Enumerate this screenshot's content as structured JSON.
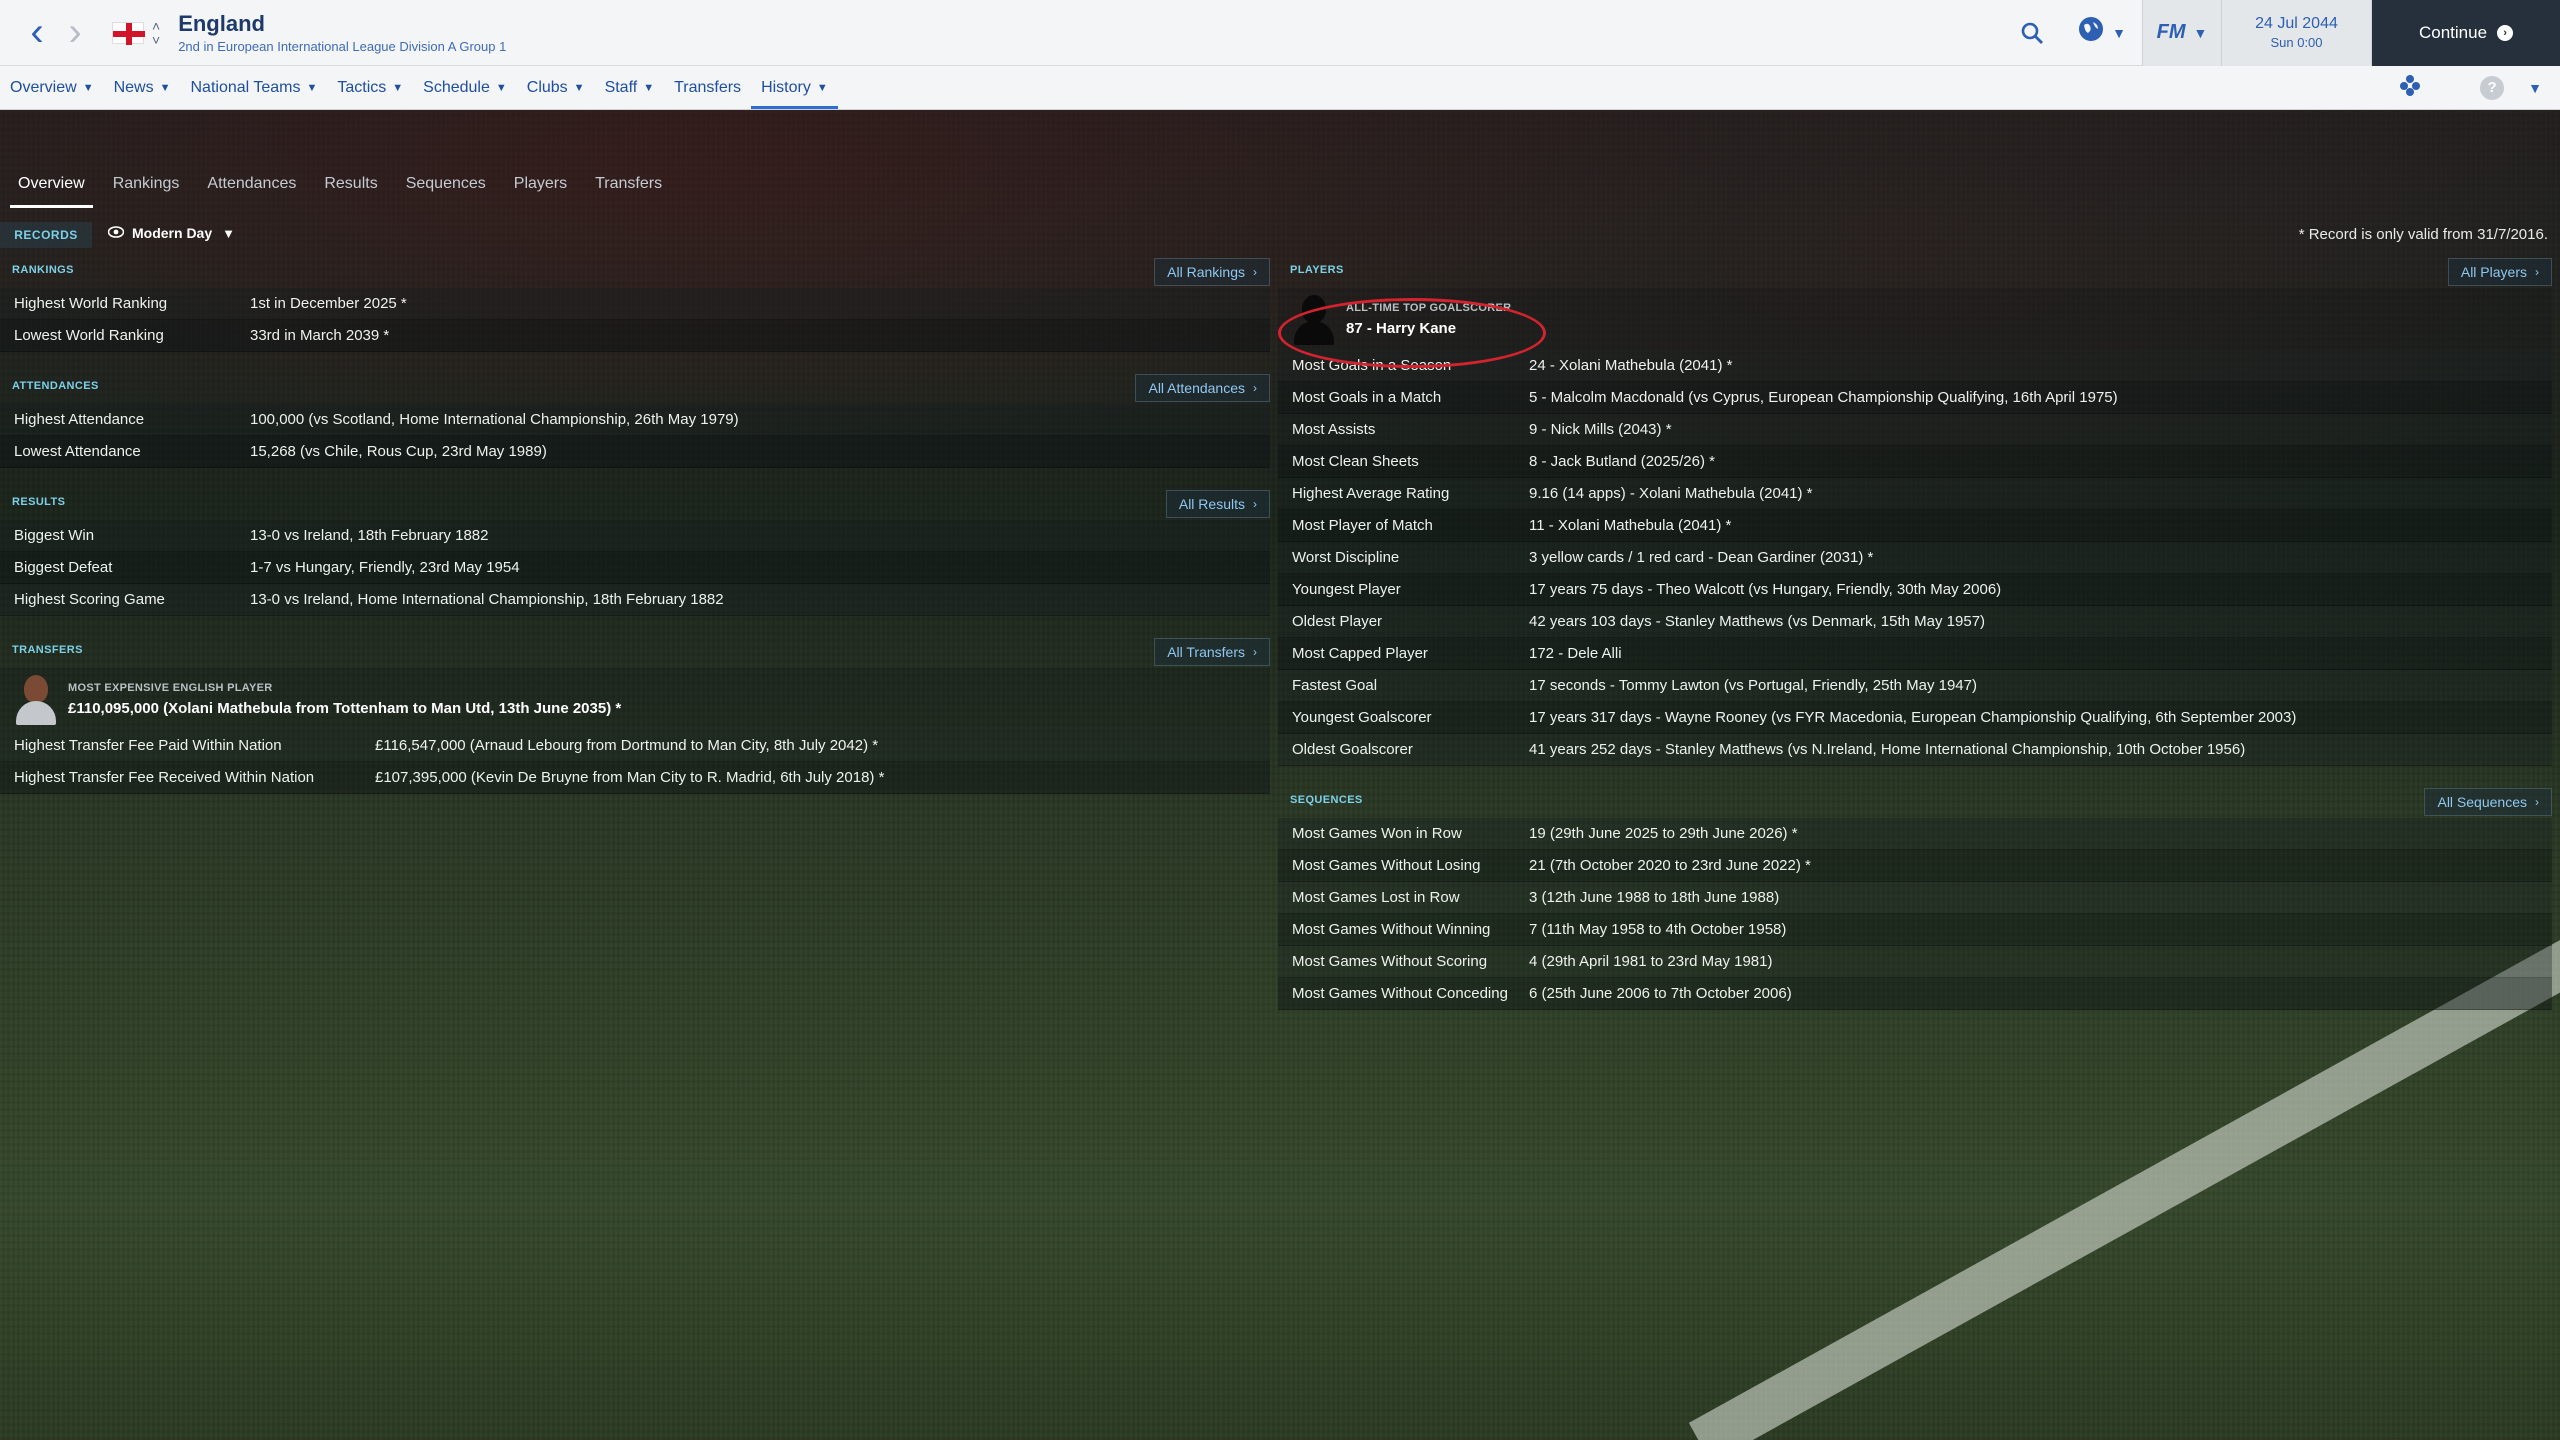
{
  "header": {
    "title": "England",
    "subtitle": "2nd in European International League Division A Group 1",
    "date": "24 Jul 2044",
    "time": "Sun 0:00",
    "continue_label": "Continue",
    "fm_label": "FM"
  },
  "menu": [
    {
      "label": "Overview",
      "has_dropdown": true
    },
    {
      "label": "News",
      "has_dropdown": true
    },
    {
      "label": "National Teams",
      "has_dropdown": true
    },
    {
      "label": "Tactics",
      "has_dropdown": true
    },
    {
      "label": "Schedule",
      "has_dropdown": true
    },
    {
      "label": "Clubs",
      "has_dropdown": true
    },
    {
      "label": "Staff",
      "has_dropdown": true
    },
    {
      "label": "Transfers",
      "has_dropdown": false
    },
    {
      "label": "History",
      "has_dropdown": true,
      "active": true
    }
  ],
  "tabs": [
    "Overview",
    "Rankings",
    "Attendances",
    "Results",
    "Sequences",
    "Players",
    "Transfers"
  ],
  "active_tab": "Overview",
  "records": {
    "label": "RECORDS",
    "filter": "Modern Day",
    "note": "* Record is only valid from 31/7/2016."
  },
  "rankings": {
    "title": "RANKINGS",
    "button": "All Rankings",
    "rows": [
      {
        "label": "Highest World Ranking",
        "value": "1st in December 2025 *"
      },
      {
        "label": "Lowest World Ranking",
        "value": "33rd in March 2039 *"
      }
    ]
  },
  "attendances": {
    "title": "ATTENDANCES",
    "button": "All Attendances",
    "rows": [
      {
        "label": "Highest Attendance",
        "value": "100,000 (vs Scotland, Home International Championship, 26th May 1979)"
      },
      {
        "label": "Lowest Attendance",
        "value": "15,268 (vs Chile, Rous Cup, 23rd May 1989)"
      }
    ]
  },
  "results": {
    "title": "RESULTS",
    "button": "All Results",
    "rows": [
      {
        "label": "Biggest Win",
        "value": "13-0 vs Ireland, 18th February 1882"
      },
      {
        "label": "Biggest Defeat",
        "value": "1-7 vs Hungary, Friendly, 23rd May 1954"
      },
      {
        "label": "Highest Scoring Game",
        "value": "13-0 vs Ireland, Home International Championship, 18th February 1882"
      }
    ]
  },
  "transfers": {
    "title": "TRANSFERS",
    "button": "All Transfers",
    "feature_caption": "MOST EXPENSIVE ENGLISH PLAYER",
    "feature_value": "£110,095,000 (Xolani Mathebula from Tottenham to Man Utd, 13th June 2035) *",
    "rows": [
      {
        "label": "Highest Transfer Fee Paid Within Nation",
        "value": "£116,547,000 (Arnaud Lebourg from Dortmund to Man City, 8th July 2042) *"
      },
      {
        "label": "Highest Transfer Fee Received Within Nation",
        "value": "£107,395,000 (Kevin De Bruyne from Man City to R. Madrid, 6th July 2018) *"
      }
    ]
  },
  "players": {
    "title": "PLAYERS",
    "button": "All Players",
    "feature_caption": "ALL-TIME TOP GOALSCORER",
    "feature_value": "87 - Harry Kane",
    "rows": [
      {
        "label": "Most Goals in a Season",
        "value": "24 - Xolani Mathebula (2041) *"
      },
      {
        "label": "Most Goals in a Match",
        "value": "5 - Malcolm Macdonald (vs Cyprus, European Championship Qualifying, 16th April 1975)"
      },
      {
        "label": "Most Assists",
        "value": "9 - Nick Mills (2043) *"
      },
      {
        "label": "Most Clean Sheets",
        "value": "8 - Jack Butland (2025/26) *"
      },
      {
        "label": "Highest Average Rating",
        "value": "9.16 (14 apps) - Xolani Mathebula (2041) *"
      },
      {
        "label": "Most Player of Match",
        "value": "11 - Xolani Mathebula (2041) *"
      },
      {
        "label": "Worst Discipline",
        "value": "3 yellow cards / 1 red card - Dean Gardiner (2031) *"
      },
      {
        "label": "Youngest Player",
        "value": "17 years 75 days - Theo Walcott (vs Hungary, Friendly, 30th May 2006)"
      },
      {
        "label": "Oldest Player",
        "value": "42 years 103 days - Stanley Matthews (vs Denmark, 15th May 1957)"
      },
      {
        "label": "Most Capped Player",
        "value": "172 - Dele Alli"
      },
      {
        "label": "Fastest Goal",
        "value": "17 seconds - Tommy Lawton (vs Portugal, Friendly, 25th May 1947)"
      },
      {
        "label": "Youngest Goalscorer",
        "value": "17 years 317 days - Wayne Rooney (vs FYR Macedonia, European Championship Qualifying, 6th September 2003)"
      },
      {
        "label": "Oldest Goalscorer",
        "value": "41 years 252 days - Stanley Matthews (vs N.Ireland, Home International Championship, 10th October 1956)"
      }
    ]
  },
  "sequences": {
    "title": "SEQUENCES",
    "button": "All Sequences",
    "rows": [
      {
        "label": "Most Games Won in Row",
        "value": "19 (29th June 2025 to 29th June 2026) *"
      },
      {
        "label": "Most Games Without Losing",
        "value": "21 (7th October 2020 to 23rd June 2022) *"
      },
      {
        "label": "Most Games Lost in Row",
        "value": "3 (12th June 1988 to 18th June 1988)"
      },
      {
        "label": "Most Games Without Winning",
        "value": "7 (11th May 1958 to 4th October 1958)"
      },
      {
        "label": "Most Games Without Scoring",
        "value": "4 (29th April 1981 to 23rd May 1981)"
      },
      {
        "label": "Most Games Without Conceding",
        "value": "6 (25th June 2006 to 7th October 2006)"
      }
    ]
  },
  "colors": {
    "accent_blue": "#2d5fb3",
    "section_title": "#7dd0e6",
    "highlight_ring": "#d3232e",
    "continue_bg": "#26303d"
  },
  "icons": [
    "back-arrow-icon",
    "forward-arrow-icon",
    "england-flag-icon",
    "search-icon",
    "globe-icon",
    "fm-logo-icon",
    "continue-arrow-icon",
    "people-icon",
    "help-icon",
    "eye-icon"
  ]
}
